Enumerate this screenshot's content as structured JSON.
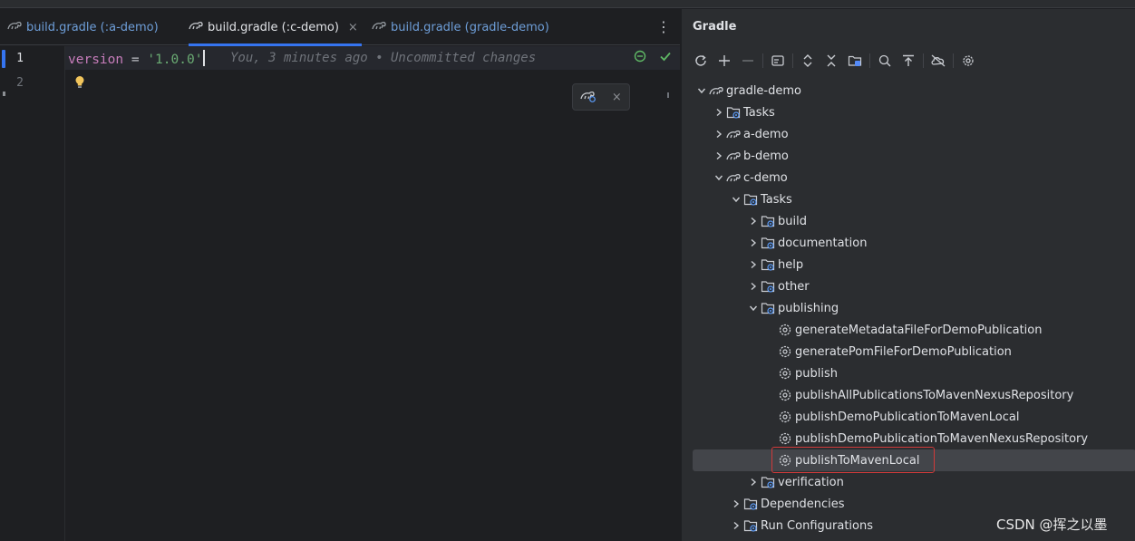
{
  "editor": {
    "tabs": [
      {
        "label": "build.gradle (:a-demo)",
        "icon": "gradle-icon"
      },
      {
        "label": "build.gradle (:c-demo)",
        "icon": "gradle-icon",
        "active": true,
        "close": "×"
      },
      {
        "label": "build.gradle (gradle-demo)",
        "icon": "gradle-icon"
      }
    ],
    "menu": "⋮",
    "line_numbers": [
      "1",
      "2"
    ],
    "code": {
      "keyword": "version",
      "operator": " = ",
      "string": "'1.0.0'"
    },
    "blame": "You, 3 minutes ago • Uncommitted changes",
    "floating_close": "×"
  },
  "gradle": {
    "title": "Gradle",
    "toolbar_icons": [
      "refresh-icon",
      "plus-icon",
      "minus-icon",
      "run-config-icon",
      "expand-all-icon",
      "collapse-all-icon",
      "folder-icon",
      "offline-icon",
      "dependencies-icon",
      "toggle-offline-icon",
      "settings-icon"
    ],
    "tree": [
      {
        "label": "gradle-demo",
        "level": 0,
        "icon": "gradle-project",
        "expanded": true
      },
      {
        "label": "Tasks",
        "level": 1,
        "icon": "folder-gear",
        "expanded": false
      },
      {
        "label": "a-demo",
        "level": 1,
        "icon": "gradle-project",
        "expanded": false
      },
      {
        "label": "b-demo",
        "level": 1,
        "icon": "gradle-project",
        "expanded": false
      },
      {
        "label": "c-demo",
        "level": 1,
        "icon": "gradle-project",
        "expanded": true
      },
      {
        "label": "Tasks",
        "level": 2,
        "icon": "folder-gear",
        "expanded": true
      },
      {
        "label": "build",
        "level": 3,
        "icon": "folder-gear",
        "expanded": false
      },
      {
        "label": "documentation",
        "level": 3,
        "icon": "folder-gear",
        "expanded": false
      },
      {
        "label": "help",
        "level": 3,
        "icon": "folder-gear",
        "expanded": false
      },
      {
        "label": "other",
        "level": 3,
        "icon": "folder-gear",
        "expanded": false
      },
      {
        "label": "publishing",
        "level": 3,
        "icon": "folder-gear",
        "expanded": true
      },
      {
        "label": "generateMetadataFileForDemoPublication",
        "level": 4,
        "icon": "gear"
      },
      {
        "label": "generatePomFileForDemoPublication",
        "level": 4,
        "icon": "gear"
      },
      {
        "label": "publish",
        "level": 4,
        "icon": "gear"
      },
      {
        "label": "publishAllPublicationsToMavenNexusRepository",
        "level": 4,
        "icon": "gear"
      },
      {
        "label": "publishDemoPublicationToMavenLocal",
        "level": 4,
        "icon": "gear"
      },
      {
        "label": "publishDemoPublicationToMavenNexusRepository",
        "level": 4,
        "icon": "gear"
      },
      {
        "label": "publishToMavenLocal",
        "level": 4,
        "icon": "gear",
        "selected": true
      },
      {
        "label": "verification",
        "level": 3,
        "icon": "folder-gear",
        "expanded": false
      },
      {
        "label": "Dependencies",
        "level": 2,
        "icon": "folder-gear",
        "expanded": false
      },
      {
        "label": "Run Configurations",
        "level": 2,
        "icon": "folder-gear",
        "expanded": false
      }
    ]
  },
  "watermark": "CSDN @挥之以墨",
  "colors": {
    "accent": "#3574f0",
    "keyword": "#c77dbb",
    "string": "#6aab73",
    "highlight_box": "#d13a3a"
  }
}
